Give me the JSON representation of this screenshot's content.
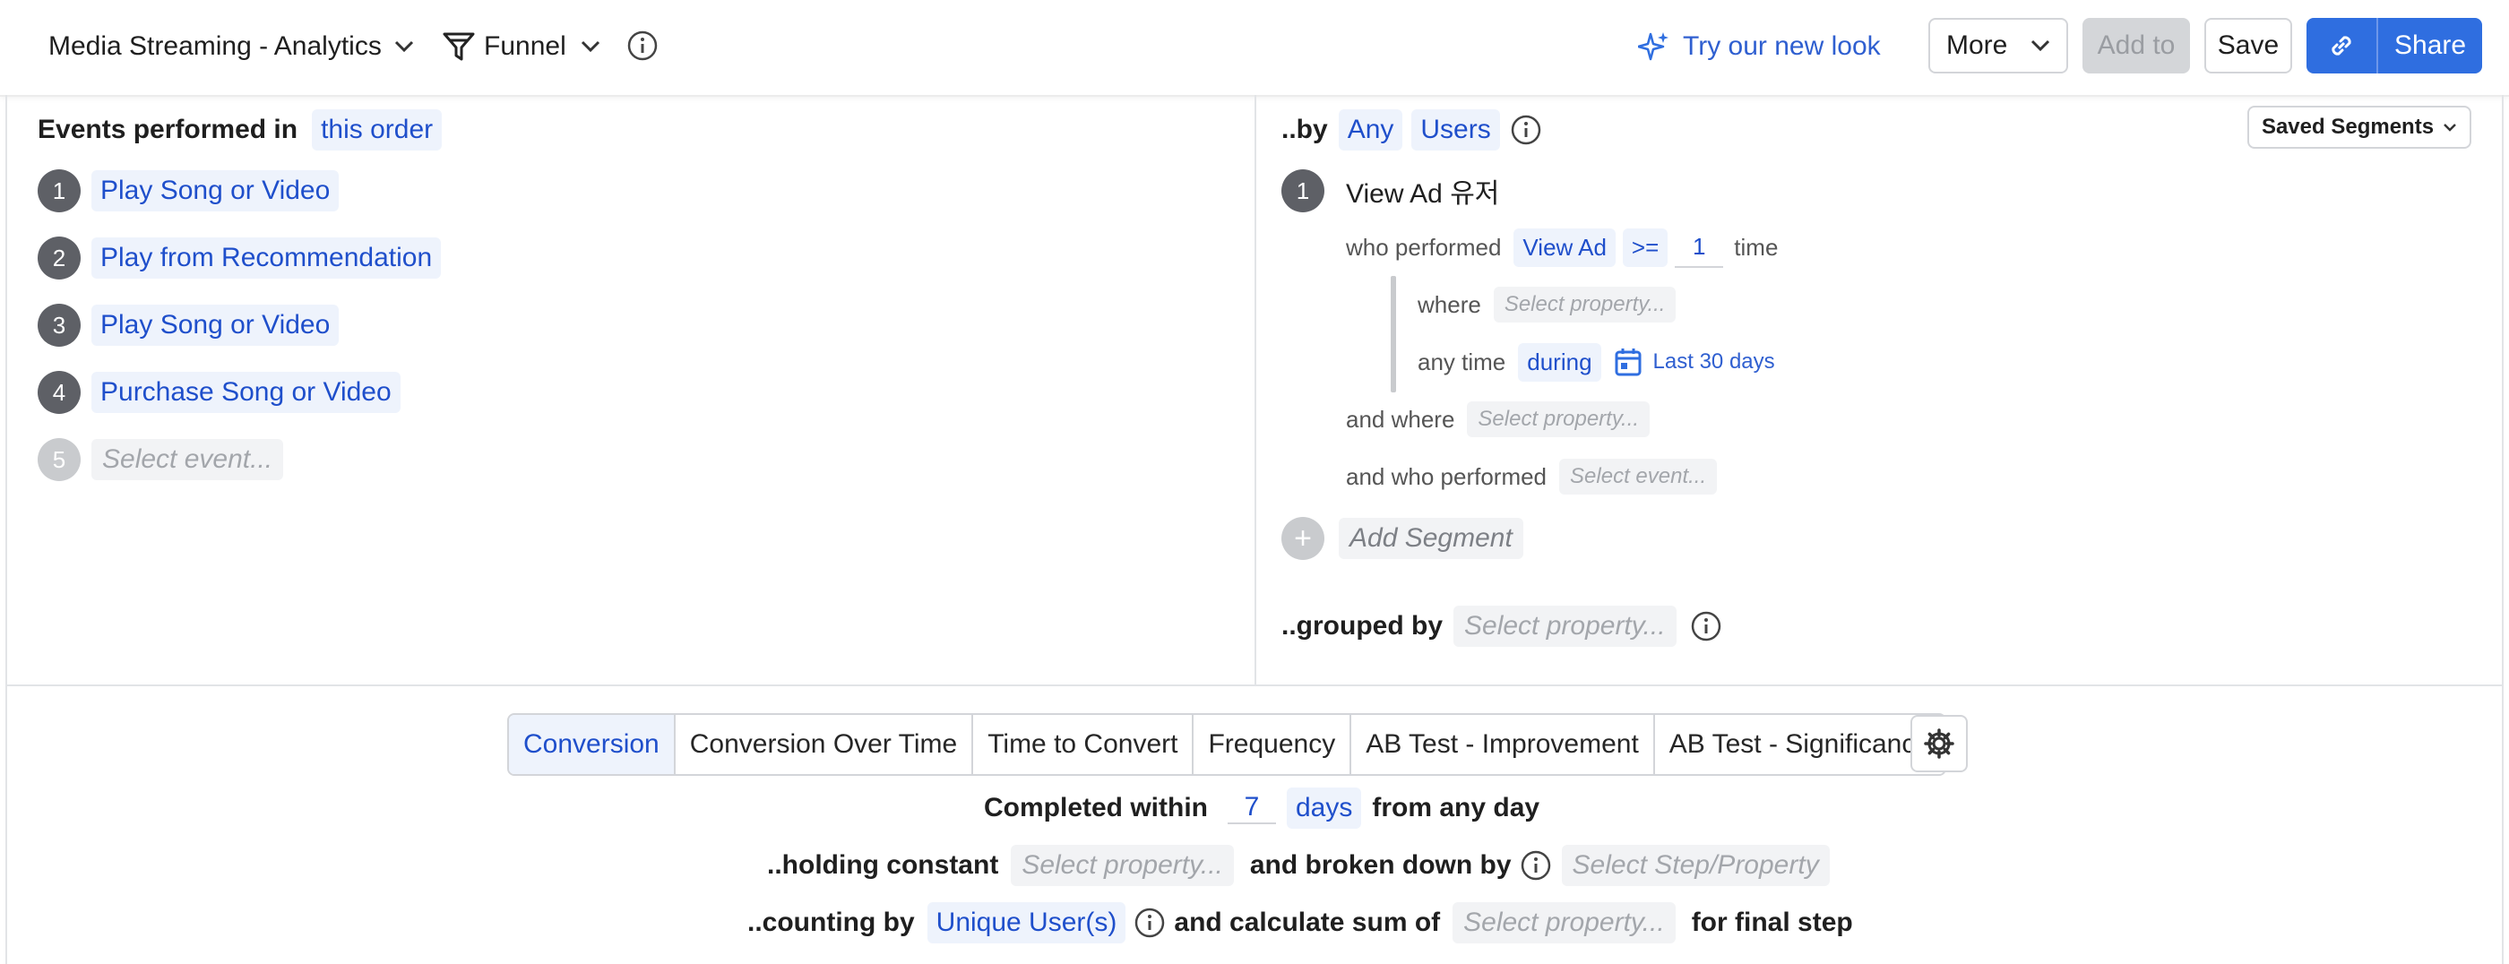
{
  "topbar": {
    "project": "Media Streaming - Analytics",
    "report_type": "Funnel",
    "try_new_look": "Try our new look",
    "more": "More",
    "add_to": "Add to",
    "save": "Save",
    "share": "Share"
  },
  "events_panel": {
    "label": "Events performed in",
    "order": "this order",
    "steps": [
      {
        "num": "1",
        "label": "Play Song or Video"
      },
      {
        "num": "2",
        "label": "Play from Recommendation"
      },
      {
        "num": "3",
        "label": "Play Song or Video"
      },
      {
        "num": "4",
        "label": "Purchase Song or Video"
      },
      {
        "num": "5",
        "label": "Select event..."
      }
    ]
  },
  "segment_panel": {
    "by": "..by",
    "any": "Any",
    "users": "Users",
    "saved_segments": "Saved Segments",
    "segment": {
      "num": "1",
      "title": "View Ad 유저",
      "who_performed": "who performed",
      "event": "View Ad",
      "operator": ">=",
      "count": "1",
      "time": "time",
      "where": "where",
      "where_placeholder": "Select property...",
      "any_time": "any time",
      "during": "during",
      "range": "Last 30 days",
      "and_where": "and where",
      "and_where_placeholder": "Select property...",
      "and_who_performed": "and who performed",
      "and_who_placeholder": "Select event..."
    },
    "add_segment": "Add Segment",
    "grouped_by": "..grouped by",
    "grouped_placeholder": "Select property..."
  },
  "bottom": {
    "tabs": [
      "Conversion",
      "Conversion Over Time",
      "Time to Convert",
      "Frequency",
      "AB Test - Improvement",
      "AB Test - Significance"
    ],
    "completed_within": "Completed within",
    "days_value": "7",
    "days_unit": "days",
    "from_any_day": "from any day",
    "holding_constant": "..holding constant",
    "holding_placeholder": "Select property...",
    "broken_down_by": "and broken down by",
    "broken_placeholder": "Select Step/Property",
    "counting_by": "..counting by",
    "counting_value": "Unique User(s)",
    "calculate_sum": "and calculate sum of",
    "sum_placeholder": "Select property...",
    "final_step": "for final step"
  },
  "colors": {
    "accent": "#1f4fcb",
    "primary_button": "#2f6ee0",
    "pill_bg": "#eef3fc"
  }
}
